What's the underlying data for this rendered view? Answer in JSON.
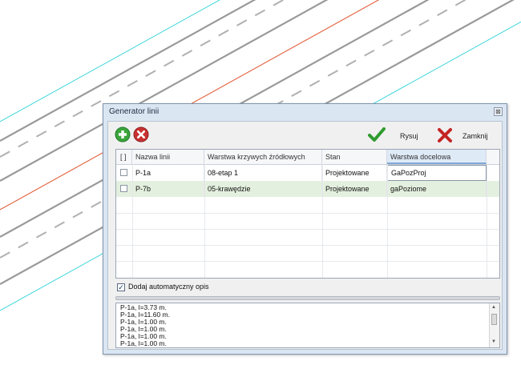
{
  "dialog": {
    "title": "Generator linii",
    "close_glyph": "⊠"
  },
  "toolbar": {
    "add_icon": "plus-circle-icon",
    "remove_icon": "x-circle-icon",
    "draw_label": "Rysuj",
    "close_label": "Zamknij",
    "colors": {
      "add": "#3aa53a",
      "remove": "#c83232",
      "draw": "#2e9b2e",
      "close": "#c42424"
    }
  },
  "grid": {
    "columns": [
      "[ ]",
      "Nazwa linii",
      "Warstwa krzywych źródłowych",
      "Stan",
      "Warstwa docelowa"
    ],
    "rows": [
      {
        "name": "P-1a",
        "source_layer": "08-etap 1",
        "state": "Projektowane",
        "target_layer": "GaPozProj"
      },
      {
        "name": "P-7b",
        "source_layer": "05-krawędzie",
        "state": "Projektowane",
        "target_layer": "gaPoziome"
      }
    ]
  },
  "options": {
    "auto_desc_label": "Dodaj automatyczny opis",
    "auto_desc_checked": true
  },
  "log": {
    "lines": [
      "P-1a, l=3.73 m.",
      "P-1a, l=11.60 m.",
      "P-1a, l=1.00 m.",
      "P-1a, l=1.00 m.",
      "P-1a, l=1.00 m.",
      "P-1a, l=1.00 m."
    ]
  }
}
